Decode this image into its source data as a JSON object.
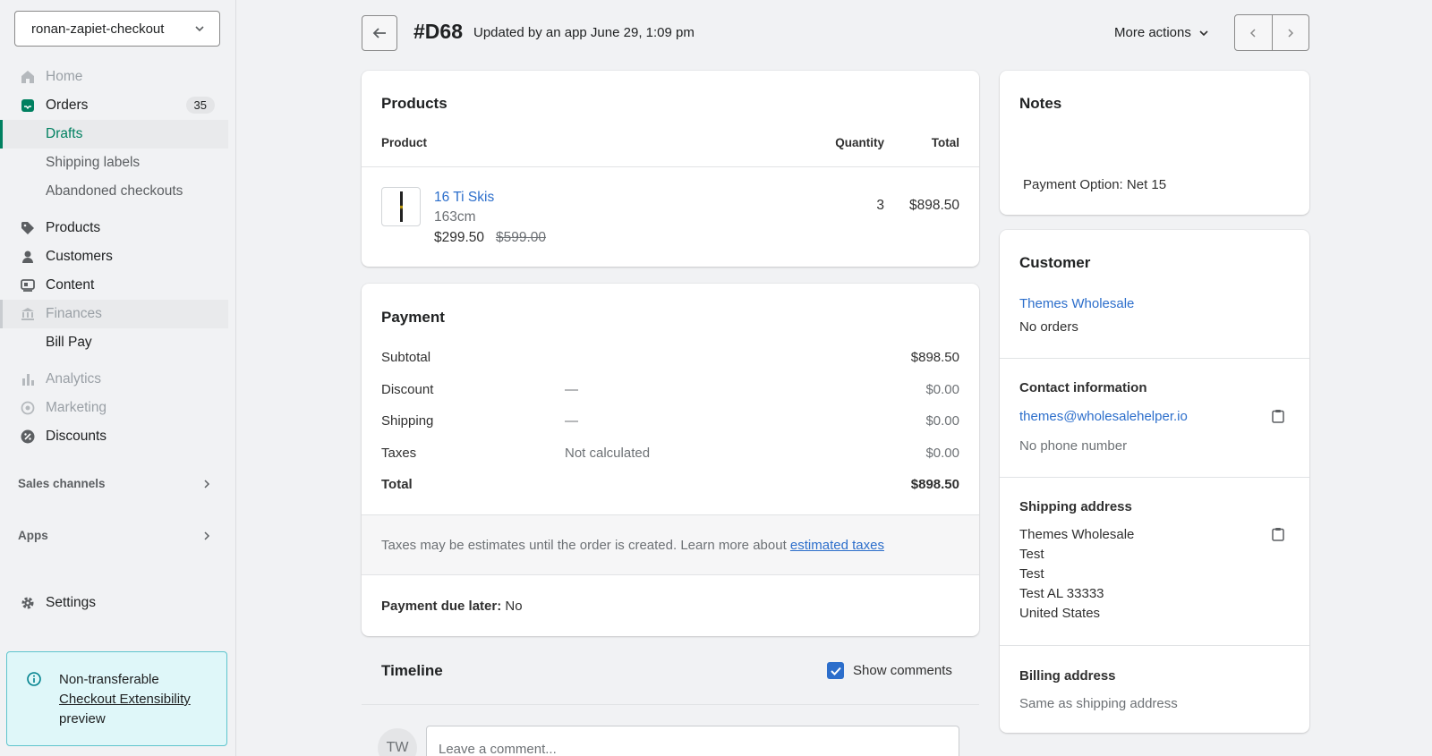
{
  "sidebar": {
    "store": "ronan-zapiet-checkout",
    "items": [
      {
        "label": "Home"
      },
      {
        "label": "Orders",
        "badge": "35"
      },
      {
        "label": "Drafts"
      },
      {
        "label": "Shipping labels"
      },
      {
        "label": "Abandoned checkouts"
      },
      {
        "label": "Products"
      },
      {
        "label": "Customers"
      },
      {
        "label": "Content"
      },
      {
        "label": "Finances"
      },
      {
        "label": "Bill Pay"
      },
      {
        "label": "Analytics"
      },
      {
        "label": "Marketing"
      },
      {
        "label": "Discounts"
      }
    ],
    "sales_channels": "Sales channels",
    "apps": "Apps",
    "settings": "Settings",
    "banner": {
      "line1": "Non-transferable",
      "link": "Checkout Extensibility",
      "line3": "preview"
    }
  },
  "header": {
    "order_id": "#D68",
    "meta": "Updated by an app June 29, 1:09 pm",
    "more_actions": "More actions"
  },
  "products": {
    "title": "Products",
    "col_product": "Product",
    "col_quantity": "Quantity",
    "col_total": "Total",
    "item": {
      "name": "16 Ti Skis",
      "variant": "163cm",
      "price": "$299.50",
      "compare_price": "$599.00",
      "quantity": "3",
      "total": "$898.50"
    }
  },
  "payment": {
    "title": "Payment",
    "rows": [
      {
        "label": "Subtotal",
        "detail": "",
        "amount": "$898.50"
      },
      {
        "label": "Discount",
        "detail": "—",
        "amount": "$0.00"
      },
      {
        "label": "Shipping",
        "detail": "—",
        "amount": "$0.00"
      },
      {
        "label": "Taxes",
        "detail": "Not calculated",
        "amount": "$0.00"
      },
      {
        "label": "Total",
        "detail": "",
        "amount": "$898.50"
      }
    ],
    "tax_note": "Taxes may be estimates until the order is created. Learn more about ",
    "tax_link": "estimated taxes",
    "due_label": "Payment due later:",
    "due_value": " No"
  },
  "timeline": {
    "title": "Timeline",
    "show_comments": "Show comments",
    "avatar": "TW",
    "comment_placeholder": "Leave a comment..."
  },
  "notes": {
    "title": "Notes",
    "text": "Payment Option: Net 15"
  },
  "customer": {
    "title": "Customer",
    "name": "Themes Wholesale",
    "orders": "No orders",
    "contact_title": "Contact information",
    "email": "themes@wholesalehelper.io",
    "phone": "No phone number",
    "shipping_title": "Shipping address",
    "shipping_lines": [
      "Themes Wholesale",
      "Test",
      "Test",
      "Test AL 33333",
      "United States"
    ],
    "billing_title": "Billing address",
    "billing_text": "Same as shipping address"
  },
  "colors": {
    "accent": "#008060",
    "link": "#2c6ecb",
    "banner_bg": "#dff7f9"
  }
}
